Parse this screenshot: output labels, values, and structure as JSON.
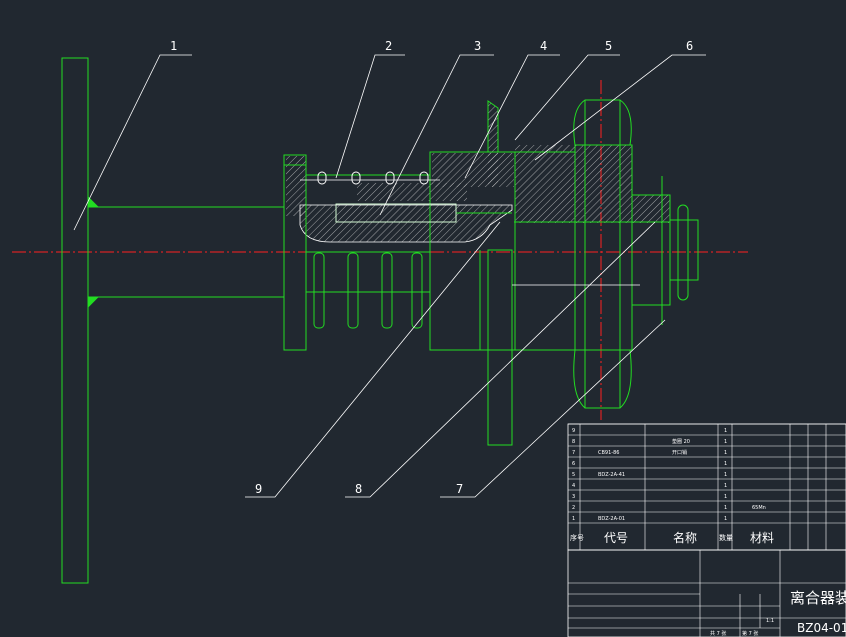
{
  "callouts": [
    "1",
    "2",
    "3",
    "4",
    "5",
    "6",
    "7",
    "8",
    "9"
  ],
  "bom": {
    "rows": [
      {
        "no": "9",
        "code": "",
        "name": "",
        "qty": "1",
        "material": ""
      },
      {
        "no": "8",
        "code": "",
        "name": "垫圈 20",
        "qty": "1",
        "material": ""
      },
      {
        "no": "7",
        "code": "CB91-86",
        "name": "开口销",
        "qty": "1",
        "material": ""
      },
      {
        "no": "6",
        "code": "",
        "name": "",
        "qty": "1",
        "material": ""
      },
      {
        "no": "5",
        "code": "BDZ-2A-41",
        "name": "",
        "qty": "1",
        "material": ""
      },
      {
        "no": "4",
        "code": "",
        "name": "",
        "qty": "1",
        "material": ""
      },
      {
        "no": "3",
        "code": "",
        "name": "",
        "qty": "1",
        "material": ""
      },
      {
        "no": "2",
        "code": "",
        "name": "",
        "qty": "1",
        "material": "65Mn"
      },
      {
        "no": "1",
        "code": "BDZ-2A-01",
        "name": "",
        "qty": "1",
        "material": ""
      }
    ],
    "header": {
      "seq": "序号",
      "code": "代号",
      "name": "名称",
      "qty": "数量",
      "material": "材料"
    }
  },
  "titleblock": {
    "title": "离合器装配",
    "drawing_no": "BZ04-01",
    "sheet_total": "共 7 张",
    "sheet_no": "第 7 张",
    "scale": "1:1"
  }
}
